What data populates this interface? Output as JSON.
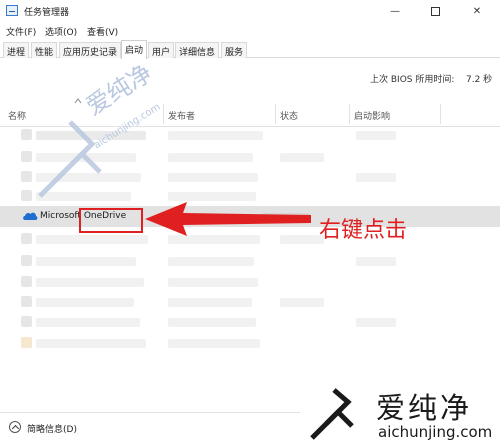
{
  "window": {
    "title": "任务管理器",
    "minimize": "—",
    "close": "✕"
  },
  "menu": [
    {
      "label": "文件(F)"
    },
    {
      "label": "选项(O)"
    },
    {
      "label": "查看(V)"
    }
  ],
  "tabs": [
    {
      "label": "进程",
      "active": false
    },
    {
      "label": "性能",
      "active": false
    },
    {
      "label": "应用历史记录",
      "active": false
    },
    {
      "label": "启动",
      "active": true
    },
    {
      "label": "用户",
      "active": false
    },
    {
      "label": "详细信息",
      "active": false
    },
    {
      "label": "服务",
      "active": false
    }
  ],
  "bios": {
    "label": "上次 BIOS 所用时间:",
    "value": "7.2 秒"
  },
  "columns": [
    {
      "label": "名称"
    },
    {
      "label": "发布者"
    },
    {
      "label": "状态"
    },
    {
      "label": "启动影响"
    }
  ],
  "highlighted_row": {
    "name": "Microsoft OneDrive",
    "name_prefix": "Microsof",
    "name_boxed": "OneDrive",
    "icon": "onedrive-cloud-icon"
  },
  "annotation": {
    "text": "右键点击",
    "color": "#e02020"
  },
  "footer": {
    "label": "简略信息(D)"
  },
  "watermark": {
    "brand": "爱纯净",
    "url": "aichunjing.com"
  },
  "colors": {
    "highlight_row": "#e2e2e2",
    "annotation_red": "#e02020",
    "onedrive_blue": "#1f6fd1"
  }
}
